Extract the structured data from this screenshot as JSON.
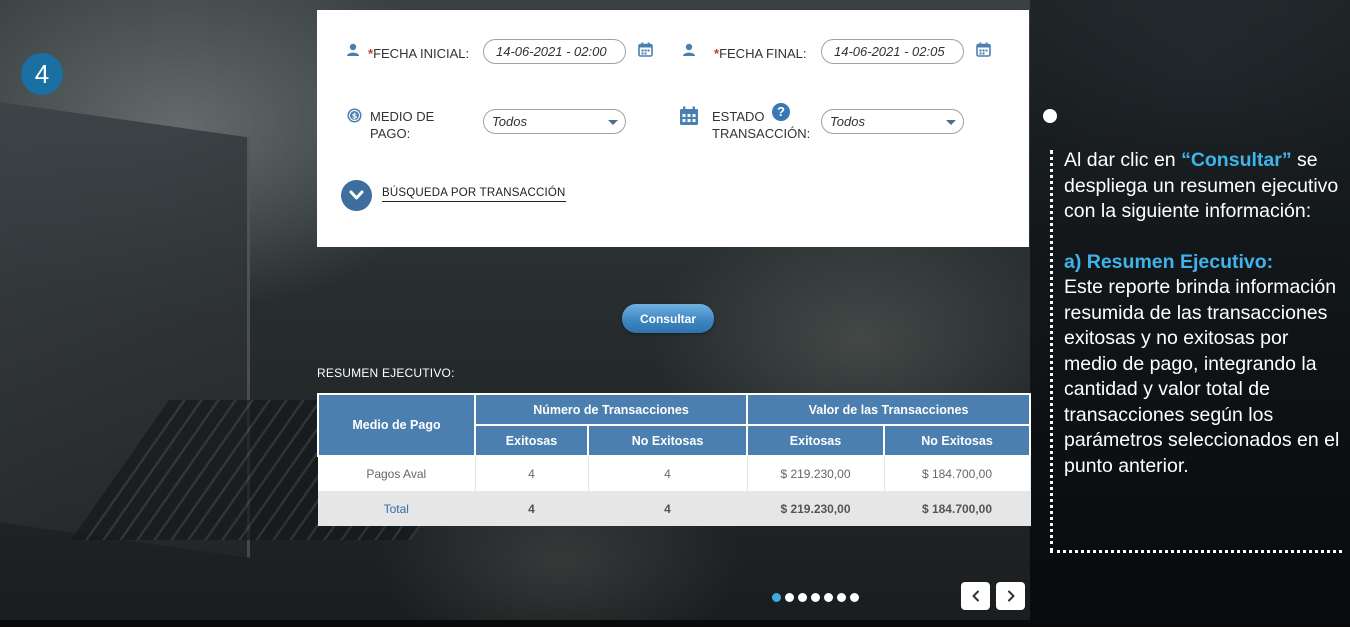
{
  "step_number": "4",
  "form": {
    "fecha_inicial_label": "FECHA INICIAL:",
    "fecha_inicial_value": "14-06-2021 - 02:00",
    "fecha_final_label": "FECHA FINAL:",
    "fecha_final_value": "14-06-2021 - 02:05",
    "required_mark": "*",
    "medio_pago_label_1": "MEDIO DE",
    "medio_pago_label_2": "PAGO:",
    "medio_pago_value": "Todos",
    "estado_label_1": "ESTADO",
    "estado_label_2": "TRANSACCIÓN:",
    "estado_value": "Todos",
    "help_glyph": "?",
    "busqueda_link": "BÚSQUEDA POR TRANSACCIÓN"
  },
  "consultar_button": "Consultar",
  "resumen_title": "RESUMEN EJECUTIVO:",
  "table": {
    "col_medio": "Medio de Pago",
    "group_numero": "Número de Transacciones",
    "group_valor": "Valor de las Transacciones",
    "sub_exitosas": "Exitosas",
    "sub_no_exitosas": "No Exitosas",
    "rows": [
      {
        "medio": "Pagos Aval",
        "num_exitosas": "4",
        "num_no_exitosas": "4",
        "val_exitosas": "$ 219.230,00",
        "val_no_exitosas": "$ 184.700,00"
      }
    ],
    "total": {
      "medio": "Total",
      "num_exitosas": "4",
      "num_no_exitosas": "4",
      "val_exitosas": "$ 219.230,00",
      "val_no_exitosas": "$ 184.700,00"
    }
  },
  "carousel": {
    "total_dots": 7,
    "active_index": 0
  },
  "explanation": {
    "intro_1": "Al dar clic en ",
    "intro_accent": "“Consultar”",
    "intro_2": " se despliega un resumen ejecutivo con la siguiente información:",
    "heading": "a) Resumen Ejecutivo:",
    "body": "Este reporte brinda información resumida de las transacciones exitosas y no exitosas por medio de pago, integrando la cantidad y valor total de transacciones según los parámetros seleccionados en el punto anterior."
  },
  "colors": {
    "accent_blue": "#3fb3ea",
    "header_blue": "#4a7fb0",
    "badge_blue": "#1a6fa3"
  }
}
